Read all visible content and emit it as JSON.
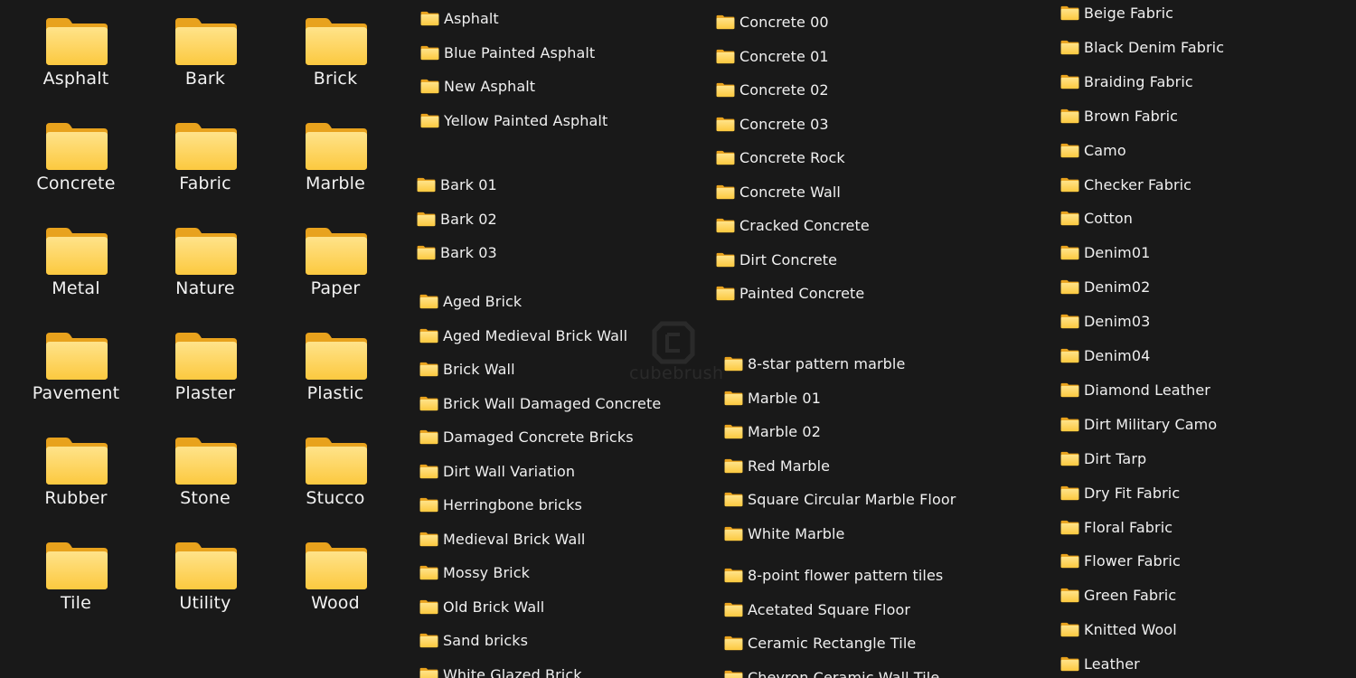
{
  "folder_icon": "folder-icon",
  "colors": {
    "background": "#191919",
    "folder_back": "#E8A21D",
    "folder_front_top": "#FFE38A",
    "folder_front_bottom": "#FCC93F",
    "text": "#F2F2F2"
  },
  "watermark": {
    "text": "cubebrush"
  },
  "large_folders": [
    "Asphalt",
    "Bark",
    "Brick",
    "Concrete",
    "Fabric",
    "Marble",
    "Metal",
    "Nature",
    "Paper",
    "Pavement",
    "Plaster",
    "Plastic",
    "Rubber",
    "Stone",
    "Stucco",
    "Tile",
    "Utility",
    "Wood"
  ],
  "lists": {
    "asphalt": [
      "Asphalt",
      "Blue Painted Asphalt",
      "New Asphalt",
      "Yellow Painted Asphalt"
    ],
    "bark": [
      "Bark 01",
      "Bark 02",
      "Bark 03"
    ],
    "brick": [
      "Aged Brick",
      "Aged Medieval Brick Wall",
      "Brick Wall",
      "Brick Wall Damaged Concrete",
      "Damaged Concrete Bricks",
      "Dirt Wall Variation",
      "Herringbone bricks",
      "Medieval Brick Wall",
      "Mossy Brick",
      "Old Brick Wall",
      "Sand bricks",
      "White Glazed Brick"
    ],
    "concrete": [
      "Concrete 00",
      "Concrete 01",
      "Concrete 02",
      "Concrete 03",
      "Concrete Rock",
      "Concrete Wall",
      "Cracked Concrete",
      "Dirt Concrete",
      "Painted Concrete"
    ],
    "marble": [
      "8-star pattern marble",
      "Marble 01",
      "Marble 02",
      "Red Marble",
      "Square Circular Marble Floor",
      "White Marble"
    ],
    "tile": [
      "8-point flower pattern tiles",
      "Acetated Square Floor",
      "Ceramic Rectangle Tile",
      "Chevron Ceramic Wall Tile"
    ],
    "fabric": [
      "Beige Fabric",
      "Black Denim Fabric",
      "Braiding Fabric",
      "Brown Fabric",
      "Camo",
      "Checker Fabric",
      "Cotton",
      "Denim01",
      "Denim02",
      "Denim03",
      "Denim04",
      "Diamond Leather",
      "Dirt Military Camo",
      "Dirt Tarp",
      "Dry Fit Fabric",
      "Floral Fabric",
      "Flower Fabric",
      "Green Fabric",
      "Knitted Wool",
      "Leather"
    ]
  }
}
